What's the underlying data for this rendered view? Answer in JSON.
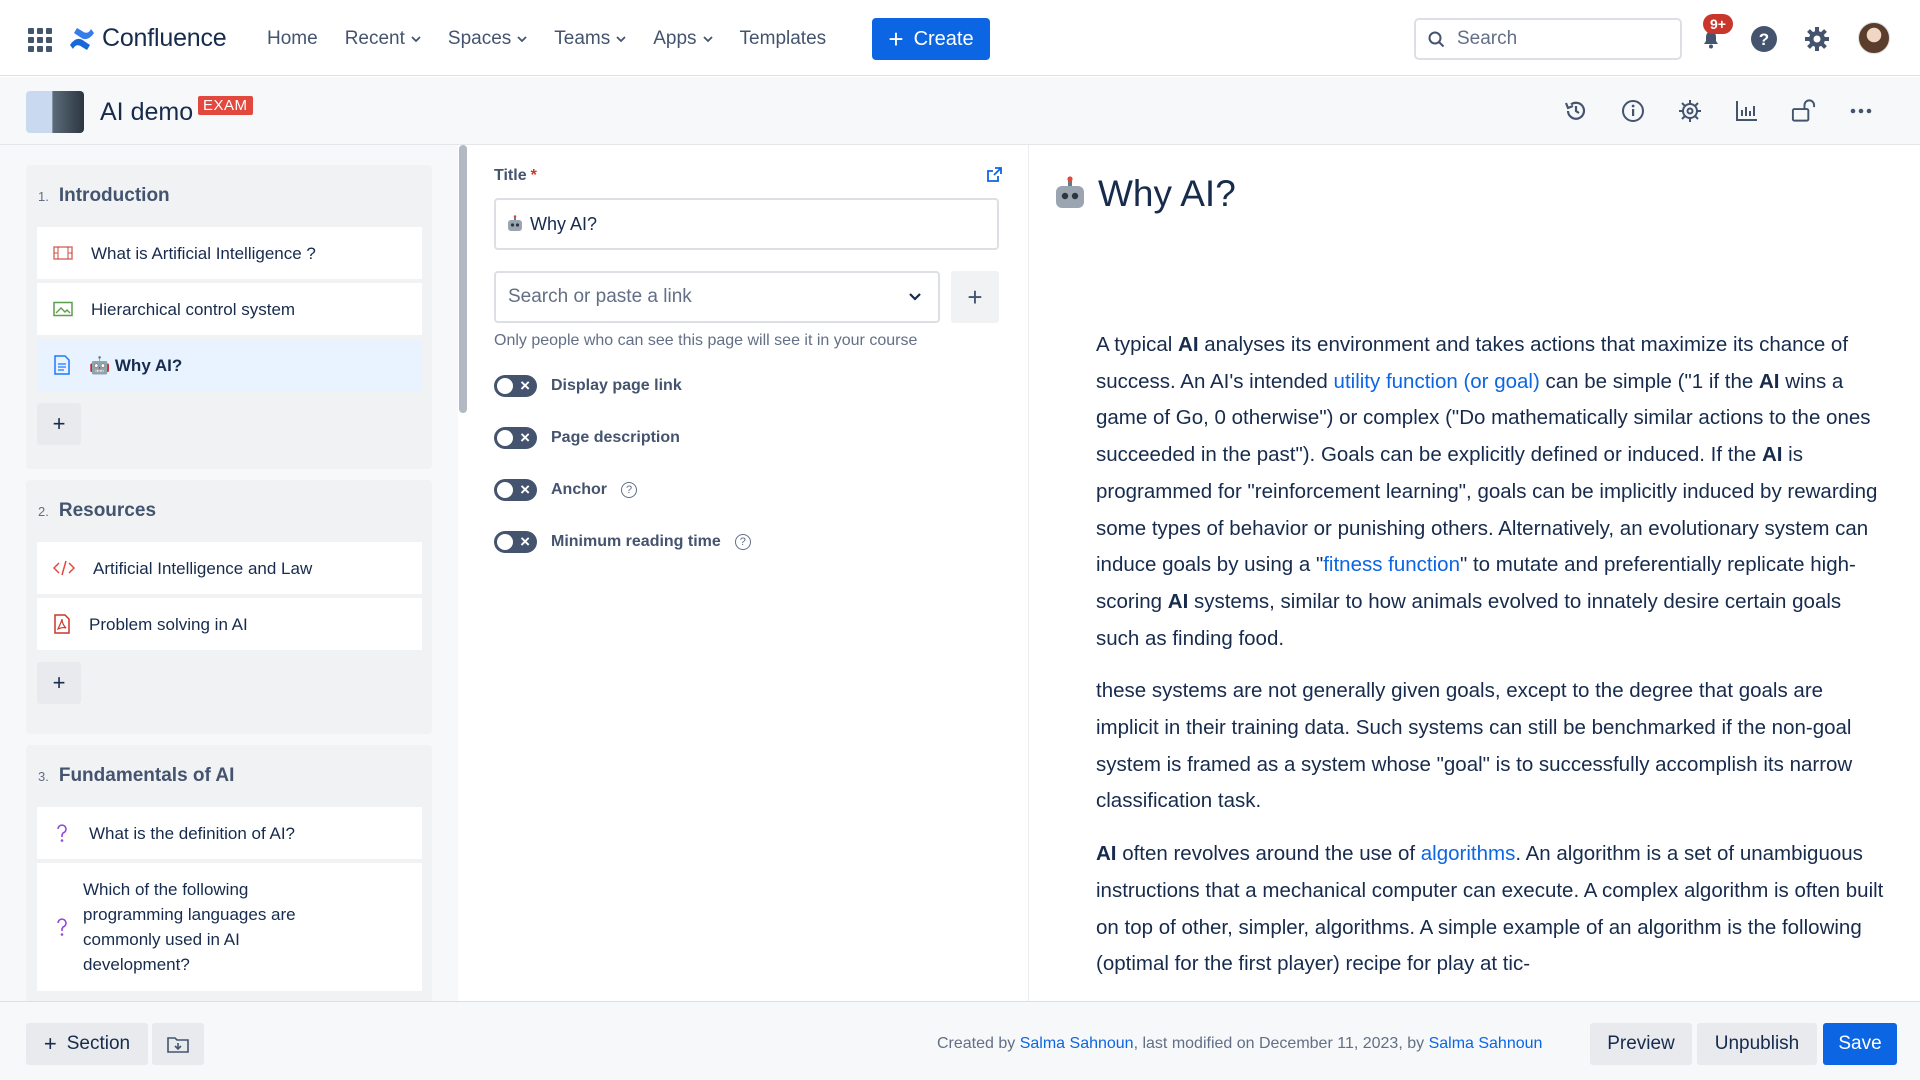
{
  "nav": {
    "logo_text": "Confluence",
    "items": [
      {
        "label": "Home",
        "dropdown": false
      },
      {
        "label": "Recent",
        "dropdown": true
      },
      {
        "label": "Spaces",
        "dropdown": true
      },
      {
        "label": "Teams",
        "dropdown": true
      },
      {
        "label": "Apps",
        "dropdown": true
      },
      {
        "label": "Templates",
        "dropdown": false
      }
    ],
    "create_label": "Create",
    "search_placeholder": "Search",
    "notification_count": "9+",
    "accent": "#0c66e4"
  },
  "space": {
    "title": "AI demo",
    "tag": "EXAM"
  },
  "sidebar": {
    "sections": [
      {
        "number": "1.",
        "title": "Introduction",
        "items": [
          {
            "icon": "video-icon",
            "label": "What is Artificial Intelligence ?"
          },
          {
            "icon": "image-icon",
            "label": "Hierarchical control system"
          },
          {
            "icon": "page-icon",
            "label": "🤖 Why AI?",
            "active": true
          }
        ]
      },
      {
        "number": "2.",
        "title": "Resources",
        "items": [
          {
            "icon": "code-icon",
            "label": "Artificial Intelligence and Law"
          },
          {
            "icon": "pdf-icon",
            "label": "Problem solving in AI"
          }
        ]
      },
      {
        "number": "3.",
        "title": "Fundamentals of AI",
        "items": [
          {
            "icon": "quiz-icon",
            "label": "What is the definition of AI?"
          },
          {
            "icon": "quiz-icon",
            "label": "Which of the following programming languages are commonly used in AI development?"
          }
        ]
      }
    ],
    "add_label": "+"
  },
  "form": {
    "title_label": "Title",
    "title_required_mark": "*",
    "title_value": "Why AI?",
    "link_placeholder": "Search or paste a link",
    "link_hint": "Only people who can see this page will see it in your course",
    "toggles": [
      {
        "label": "Display page link",
        "help": false
      },
      {
        "label": "Page description",
        "help": false
      },
      {
        "label": "Anchor",
        "help": true
      },
      {
        "label": "Minimum reading time",
        "help": true
      }
    ]
  },
  "preview": {
    "title": "Why AI?"
  },
  "footer": {
    "section_label": "Section",
    "meta_created_by": "Created by",
    "meta_author": "Salma Sahnoun",
    "meta_modified": ", last modified on December 11, 2023, by",
    "meta_modifier": "Salma Sahnoun",
    "preview_label": "Preview",
    "unpublish_label": "Unpublish",
    "save_label": "Save"
  }
}
